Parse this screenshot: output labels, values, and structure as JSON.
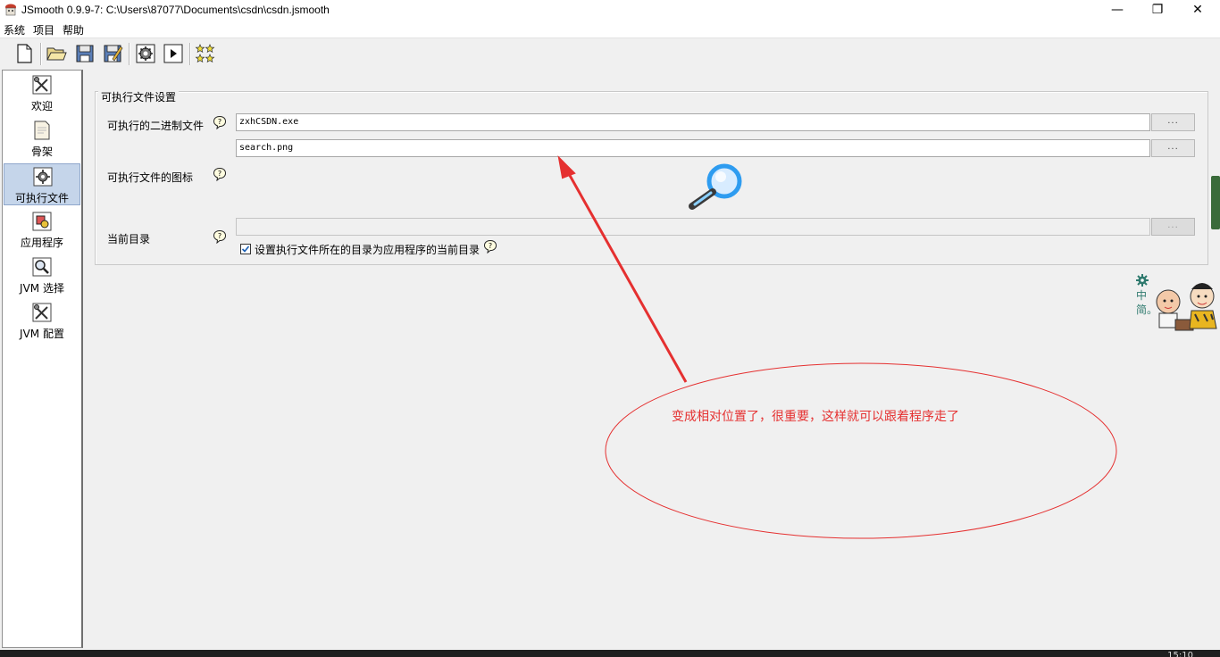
{
  "window": {
    "title": "JSmooth 0.9.9-7: C:\\Users\\87077\\Documents\\csdn\\csdn.jsmooth",
    "minimize": "—",
    "maximize": "❐",
    "close": "✕"
  },
  "menu": [
    "系统",
    "项目",
    "帮助"
  ],
  "toolbar": {
    "icons": [
      "new-file-icon",
      "open-folder-icon",
      "save-icon",
      "save-as-icon",
      "compile-icon",
      "run-icon",
      "stars-icon"
    ]
  },
  "sidebar": {
    "items": [
      {
        "label": "欢迎",
        "icon": "tools-icon"
      },
      {
        "label": "骨架",
        "icon": "skeleton-icon"
      },
      {
        "label": "可执行文件",
        "icon": "gear-icon",
        "selected": true
      },
      {
        "label": "应用程序",
        "icon": "application-icon"
      },
      {
        "label": "JVM 选择",
        "icon": "magnifier-icon"
      },
      {
        "label": "JVM 配置",
        "icon": "tools-icon"
      }
    ]
  },
  "executable": {
    "group_title": "可执行文件设置",
    "binary_label": "可执行的二进制文件",
    "binary_value": "zxhCSDN.exe",
    "icon_label": "可执行文件的图标",
    "icon_value": "search.png",
    "browse": "...",
    "cwd_label": "当前目录",
    "cwd_value": "",
    "checkbox_label": "设置执行文件所在的目录为应用程序的当前目录",
    "checkbox_checked": true
  },
  "annotation": {
    "text": "变成相对位置了，很重要，这样就可以跟着程序走了",
    "color": "#e53030"
  },
  "sticker": {
    "text": "中简。"
  },
  "taskbar": {
    "clock": "15:10"
  },
  "colors": {
    "selected_nav": "#c5d5ea",
    "annotation": "#e53030",
    "background": "#f0f0f0"
  }
}
